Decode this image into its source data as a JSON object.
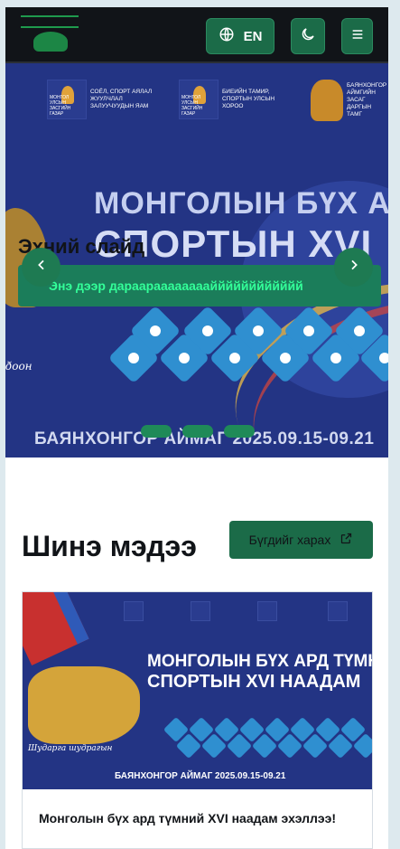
{
  "header": {
    "language_label": "EN",
    "icons": {
      "language": "globe-icon",
      "theme": "moon-icon",
      "menu": "hamburger-icon"
    }
  },
  "hero": {
    "orgs": [
      {
        "name": "СОЁЛ, СПОРТ АЯЛАЛ ЖУУЛЧЛАЛ ЗАЛУУЧУУДЫН ЯАМ",
        "emblem_caption": "МОНГОЛ УЛСЫН ЗАСГИЙН ГАЗАР"
      },
      {
        "name": "БИЕИЙН ТАМИР, СПОРТЫН УЛСЫН ХОРОО",
        "emblem_caption": "МОНГОЛ УЛСЫН ЗАСГИЙН ГАЗАР"
      },
      {
        "name": "БАЯНХОНГОР АЙМГИЙН ЗАСАГ ДАРГЫН ТАМГ"
      }
    ],
    "title_line1": "МОНГОЛЫН  БҮХ АР",
    "title_line2": "СПОРТЫН XVI",
    "slide_title": "Эхний слайд",
    "slide_subtitle": "Энэ дээр дараараааааааайййййййййййй",
    "script_text": "ðoон",
    "date_line": "БАЯНХОНГОР АЙМАГ  2025.09.15-09.21",
    "slide_count": 3,
    "active_slide": 1,
    "accent": "#1b6b48"
  },
  "news": {
    "section_title": "Шинэ мэдээ",
    "view_all_label": "Бүгдийг харах",
    "cards": [
      {
        "image_title_line1": "МОНГОЛЫН  БҮХ АРД ТҮМНИЙ",
        "image_title_line2": "СПОРТЫН XVI  НААДАМ",
        "image_date": "БАЯНХОНГОР АЙМАГ  2025.09.15-09.21",
        "image_script": "Шударга шудрагын",
        "headline": "Монголын бүх ард түмний XVI наадам эхэллээ!"
      }
    ]
  }
}
